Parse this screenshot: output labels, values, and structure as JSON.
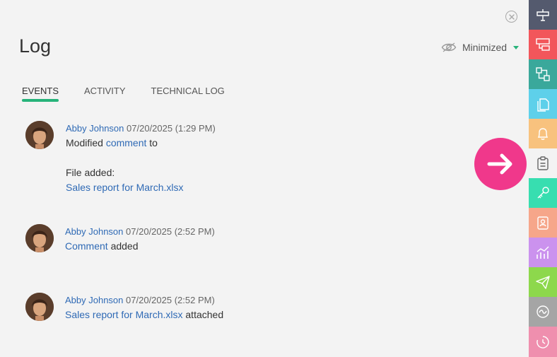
{
  "panel": {
    "title": "Log",
    "view_mode": {
      "label": "Minimized",
      "icon": "eye-icon",
      "caret_color": "#27b37a"
    }
  },
  "tabs": [
    {
      "label": "EVENTS",
      "active": true
    },
    {
      "label": "ACTIVITY",
      "active": false
    },
    {
      "label": "TECHNICAL LOG",
      "active": false
    }
  ],
  "entries": [
    {
      "author": "Abby Johnson",
      "timestamp": "07/20/2025 (1:29 PM)",
      "line1_prefix": "Modified",
      "line1_link": "comment",
      "line1_suffix": "to",
      "file_label": "File added:",
      "file_link": "Sales report for March.xlsx"
    },
    {
      "author": "Abby Johnson",
      "timestamp": "07/20/2025 (2:52 PM)",
      "line1_link": "Comment",
      "line1_suffix": "added"
    },
    {
      "author": "Abby Johnson",
      "timestamp": "07/20/2025 (2:52 PM)",
      "line1_link": "Sales report for March.xlsx",
      "line1_suffix": "attached"
    }
  ],
  "colors": {
    "accent_green": "#27b37a",
    "link_blue": "#2f6ab5",
    "fab_pink": "#f0388b"
  },
  "sidebar": [
    {
      "icon": "signpost-icon",
      "color": "#545a6e"
    },
    {
      "icon": "layout-blocks-icon",
      "color": "#f2565b"
    },
    {
      "icon": "connected-boxes-icon",
      "color": "#3aa89b"
    },
    {
      "icon": "documents-icon",
      "color": "#5ed0ea"
    },
    {
      "icon": "bell-icon",
      "color": "#f8c27e"
    },
    {
      "icon": "clipboard-icon",
      "color": "#f3f3f3"
    },
    {
      "icon": "key-icon",
      "color": "#37deb0"
    },
    {
      "icon": "contact-card-icon",
      "color": "#f6a68a"
    },
    {
      "icon": "analytics-chart-icon",
      "color": "#cb92ee"
    },
    {
      "icon": "paper-plane-icon",
      "color": "#8dd84c"
    },
    {
      "icon": "wave-circle-icon",
      "color": "#a5a5a5"
    },
    {
      "icon": "clock-icon",
      "color": "#ef8fae"
    }
  ]
}
